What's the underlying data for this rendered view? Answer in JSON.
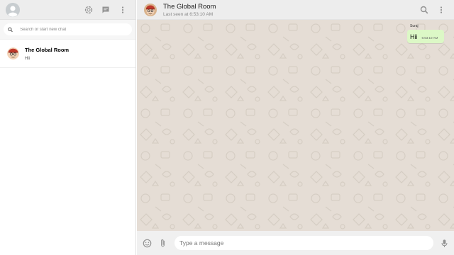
{
  "sidebar": {
    "search": {
      "placeholder": "Search or start new chat"
    },
    "chats": [
      {
        "name": "The Global Room",
        "last_message": "Hii"
      }
    ]
  },
  "main": {
    "header": {
      "room_name": "The Global Room",
      "status": "Last seen at 6:53:10 AM"
    },
    "messages": [
      {
        "sender": "Suraj",
        "text": "Hii",
        "time": "6:53:10 AM"
      }
    ],
    "composer": {
      "placeholder": "Type a message"
    }
  },
  "colors": {
    "header_bg": "#ededed",
    "chat_bg": "#e5ddd5",
    "outgoing_bubble": "#dcf8c6",
    "icon": "#919191"
  },
  "icons": {
    "status": "status-ring-icon",
    "new_chat": "chat-bubble-icon",
    "menu": "dots-vertical-icon",
    "search": "search-icon",
    "emoji": "emoji-icon",
    "attach": "paperclip-icon",
    "mic": "mic-icon"
  }
}
